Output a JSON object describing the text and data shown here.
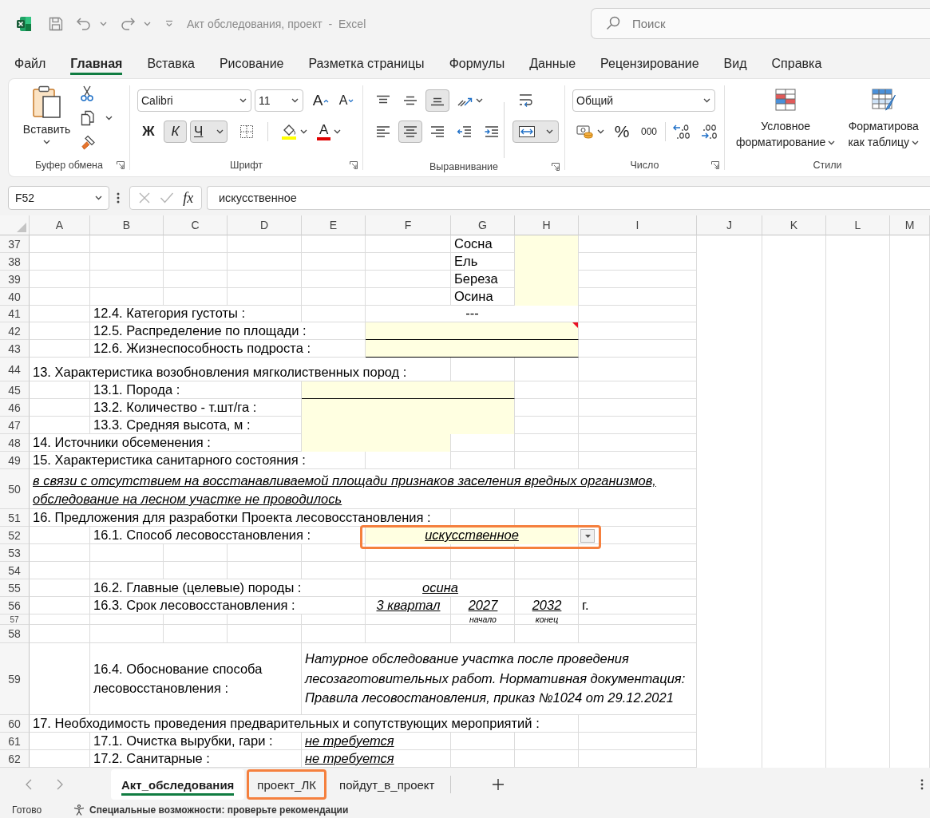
{
  "title_bar": {
    "title": "Акт обследования, проект  -  Excel",
    "search_placeholder": "Поиск"
  },
  "menu_tabs": [
    {
      "label": "Файл",
      "selected": false
    },
    {
      "label": "Главная",
      "selected": true
    },
    {
      "label": "Вставка",
      "selected": false
    },
    {
      "label": "Рисование",
      "selected": false
    },
    {
      "label": "Разметка страницы",
      "selected": false
    },
    {
      "label": "Формулы",
      "selected": false
    },
    {
      "label": "Данные",
      "selected": false
    },
    {
      "label": "Рецензирование",
      "selected": false
    },
    {
      "label": "Вид",
      "selected": false
    },
    {
      "label": "Справка",
      "selected": false
    }
  ],
  "ribbon": {
    "clipboard": {
      "label": "Буфер обмена",
      "paste": "Вставить"
    },
    "font": {
      "label": "Шрифт",
      "font_name": "Calibri",
      "font_size": "11",
      "grow": "A",
      "shrink": "A",
      "bold": {
        "label": "Ж",
        "on": false
      },
      "italic": {
        "label": "К",
        "on": true
      },
      "underline": {
        "label": "Ч",
        "on": true
      },
      "font_color": "A"
    },
    "alignment": {
      "label": "Выравнивание",
      "vertical": [
        {
          "kind": "top",
          "selected": false
        },
        {
          "kind": "middle",
          "selected": false
        },
        {
          "kind": "bottom",
          "selected": true
        }
      ],
      "horizontal": [
        {
          "kind": "left",
          "selected": false
        },
        {
          "kind": "center",
          "selected": true
        },
        {
          "kind": "right",
          "selected": false
        }
      ],
      "merge": {
        "on": true
      }
    },
    "number": {
      "label": "Число",
      "format": "Общий",
      "percent": "%",
      "thousands": "000"
    },
    "styles": {
      "label": "Стили",
      "buttons": [
        {
          "kind": "conditional",
          "label": "Условное\nформатирование"
        },
        {
          "kind": "table",
          "label": "Форматирова\nкак таблицу"
        }
      ]
    }
  },
  "formula_bar": {
    "cell": "F52",
    "function_label": "fx",
    "value": "искусственное"
  },
  "sheet": {
    "columns": [
      "A",
      "B",
      "C",
      "D",
      "E",
      "F",
      "G",
      "H",
      "I",
      "J",
      "K",
      "L",
      "M"
    ],
    "rows": [
      {
        "number": "37",
        "cells": [
          {
            "kind": "label",
            "text": "Сосна"
          },
          {
            "kind": "input",
            "underlined": false,
            "comment": false
          }
        ]
      },
      {
        "number": "38",
        "cells": [
          {
            "kind": "label",
            "text": "Ель"
          },
          {
            "kind": "input",
            "underlined": false,
            "comment": false
          }
        ]
      },
      {
        "number": "39",
        "cells": [
          {
            "kind": "label",
            "text": "Береза"
          },
          {
            "kind": "input",
            "underlined": false,
            "comment": false
          }
        ]
      },
      {
        "number": "40",
        "cells": [
          {
            "kind": "label",
            "text": "Осина"
          },
          {
            "kind": "input",
            "underlined": false,
            "comment": false
          }
        ]
      },
      {
        "number": "41",
        "cells": [
          {
            "kind": "label",
            "text": "12.4. Категория густоты :"
          },
          {
            "kind": "centered",
            "text": "---"
          }
        ]
      },
      {
        "number": "42",
        "cells": [
          {
            "kind": "label",
            "text": "12.5. Распределение по площади :"
          },
          {
            "kind": "input",
            "underlined": true,
            "comment": true
          }
        ]
      },
      {
        "number": "43",
        "cells": [
          {
            "kind": "label",
            "text": "12.6. Жизнеспособность подроста :"
          },
          {
            "kind": "input",
            "underlined": true,
            "comment": false
          }
        ]
      },
      {
        "number": "44",
        "cells": [
          {
            "kind": "label",
            "text": "13. Характеристика возобновления мягколиственных пород :"
          }
        ]
      },
      {
        "number": "45",
        "cells": [
          {
            "kind": "label",
            "text": "13.1. Порода :"
          },
          {
            "kind": "input",
            "underlined": true,
            "comment": false
          }
        ]
      },
      {
        "number": "46",
        "cells": [
          {
            "kind": "label",
            "text": "13.2. Количество - т.шт/га :"
          },
          {
            "kind": "input",
            "underlined": false,
            "comment": false
          }
        ]
      },
      {
        "number": "47",
        "cells": [
          {
            "kind": "label",
            "text": "13.3. Средняя высота, м :"
          },
          {
            "kind": "input",
            "underlined": false,
            "comment": false
          }
        ]
      },
      {
        "number": "48",
        "cells": [
          {
            "kind": "label",
            "text": "14. Источники обсеменения :"
          },
          {
            "kind": "input",
            "underlined": false,
            "comment": false
          }
        ]
      },
      {
        "number": "49",
        "cells": [
          {
            "kind": "label",
            "text": "15. Характеристика санитарного состояния :"
          }
        ]
      },
      {
        "number": "50",
        "cells": [
          {
            "kind": "note",
            "text": "в связи с отсутствием на восстанавливаемой площади признаков заселения вредных организмов,\nобследование на лесном участке не проводилось"
          }
        ]
      },
      {
        "number": "51",
        "cells": [
          {
            "kind": "label",
            "text": "16. Предложения для разработки Проекта лесовосстановления :"
          }
        ]
      },
      {
        "number": "52",
        "cells": [
          {
            "kind": "label",
            "text": "16.1. Способ лесовосстановления :"
          },
          {
            "kind": "choice",
            "text": "искусственное",
            "highlighted": true
          }
        ]
      },
      {
        "number": "53"
      },
      {
        "number": "54"
      },
      {
        "number": "55",
        "cells": [
          {
            "kind": "label",
            "text": "16.2. Главные (целевые) породы :"
          },
          {
            "kind": "entry",
            "text": "осина"
          }
        ]
      },
      {
        "number": "56",
        "cells": [
          {
            "kind": "label",
            "text": "16.3. Срок лесовосстановления :"
          },
          {
            "kind": "entry",
            "text": "3 квартал"
          },
          {
            "kind": "entry",
            "text": "2027"
          },
          {
            "kind": "entry",
            "text": "2032"
          },
          {
            "kind": "unit",
            "text": "г."
          }
        ]
      },
      {
        "number": "57",
        "cells": [
          {
            "kind": "caption",
            "text": "начало"
          },
          {
            "kind": "caption",
            "text": "конец"
          }
        ]
      },
      {
        "number": "58"
      },
      {
        "number": "59",
        "cells": [
          {
            "kind": "wrapped",
            "text": "16.4. Обоснование способа\nлесовосстановления :"
          },
          {
            "kind": "justification",
            "text": "Натурное обследование участка после проведения\nлесозаготовительных работ. Нормативная документация:\nПравила лесовостановления, приказ №1024 от 29.12.2021"
          }
        ]
      },
      {
        "number": "60",
        "cells": [
          {
            "kind": "label",
            "text": "17. Необходимость проведения предварительных и сопутствующих мероприятий :"
          }
        ]
      },
      {
        "number": "61",
        "cells": [
          {
            "kind": "label",
            "text": "17.1. Очистка вырубки, гари :"
          },
          {
            "kind": "remark",
            "text": "не требуется"
          }
        ]
      },
      {
        "number": "62",
        "cells": [
          {
            "kind": "label",
            "text": "17.2. Санитарные :"
          },
          {
            "kind": "remark",
            "text": "не требуется"
          }
        ]
      }
    ]
  },
  "sheet_tabs": [
    {
      "label": "Акт_обследования",
      "selected": true,
      "highlighted": false
    },
    {
      "label": "проект_ЛК",
      "selected": false,
      "highlighted": true
    },
    {
      "label": "пойдут_в_проект",
      "selected": false,
      "highlighted": false
    }
  ],
  "status_bar": {
    "mode": "Готово",
    "accessibility": "Специальные возможности: проверьте рекомендации"
  }
}
